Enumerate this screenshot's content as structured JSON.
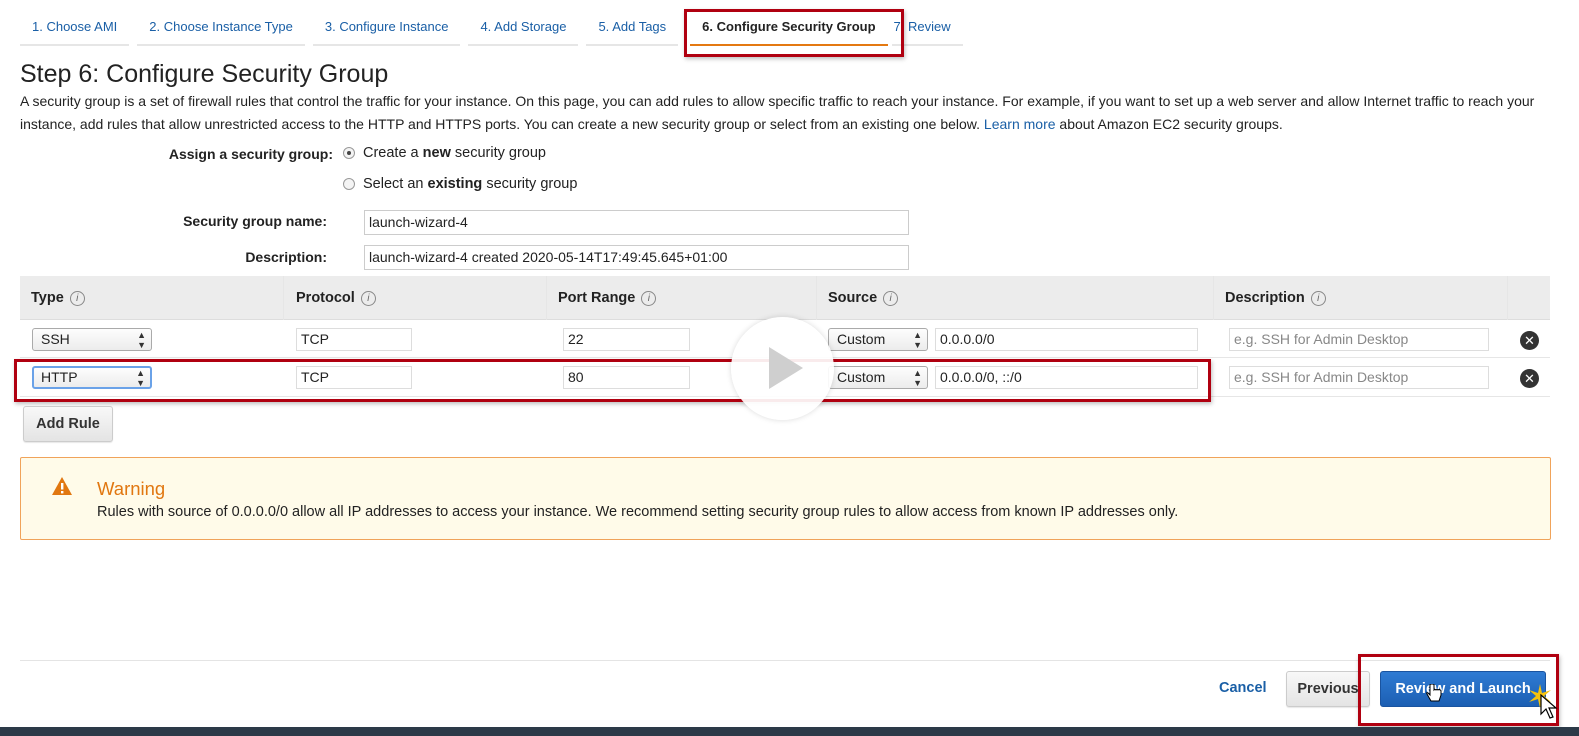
{
  "tabs": [
    {
      "label": "1. Choose AMI"
    },
    {
      "label": "2. Choose Instance Type"
    },
    {
      "label": "3. Configure Instance"
    },
    {
      "label": "4. Add Storage"
    },
    {
      "label": "5. Add Tags"
    },
    {
      "label": "6. Configure Security Group"
    },
    {
      "label": "7. Review"
    }
  ],
  "page": {
    "title": "Step 6: Configure Security Group",
    "intro_text": "A security group is a set of firewall rules that control the traffic for your instance. On this page, you can add rules to allow specific traffic to reach your instance. For example, if you want to set up a web server and allow Internet traffic to reach your instance, add rules that allow unrestricted access to the HTTP and HTTPS ports. You can create a new security group or select from an existing one below.",
    "learn_more": "Learn more",
    "intro_suffix": "about Amazon EC2 security groups."
  },
  "assign": {
    "label": "Assign a security group:",
    "option_new_prefix": "Create a",
    "option_new_bold": "new",
    "option_new_suffix": "security group",
    "option_existing_prefix": "Select an",
    "option_existing_bold": "existing",
    "option_existing_suffix": "security group",
    "selected": "new"
  },
  "form": {
    "name_label": "Security group name:",
    "name_value": "launch-wizard-4",
    "desc_label": "Description:",
    "desc_value": "launch-wizard-4 created 2020-05-14T17:49:45.645+01:00"
  },
  "table": {
    "headers": [
      "Type",
      "Protocol",
      "Port Range",
      "Source",
      "Description"
    ],
    "rows": [
      {
        "type": "SSH",
        "protocol": "TCP",
        "port": "22",
        "source_type": "Custom",
        "source": "0.0.0.0/0",
        "description_placeholder": "e.g. SSH for Admin Desktop"
      },
      {
        "type": "HTTP",
        "protocol": "TCP",
        "port": "80",
        "source_type": "Custom",
        "source": "0.0.0.0/0, ::/0",
        "description_placeholder": "e.g. SSH for Admin Desktop"
      }
    ],
    "add_rule": "Add Rule"
  },
  "warning": {
    "title": "Warning",
    "text": "Rules with source of 0.0.0.0/0 allow all IP addresses to access your instance. We recommend setting security group rules to allow access from known IP addresses only."
  },
  "footer": {
    "cancel": "Cancel",
    "previous": "Previous",
    "review_launch": "Review and Launch"
  },
  "colors": {
    "link": "#1a5fa6",
    "highlight": "#b00010",
    "warning_orange": "#e17710",
    "primary_button": "#1c5fb3"
  }
}
